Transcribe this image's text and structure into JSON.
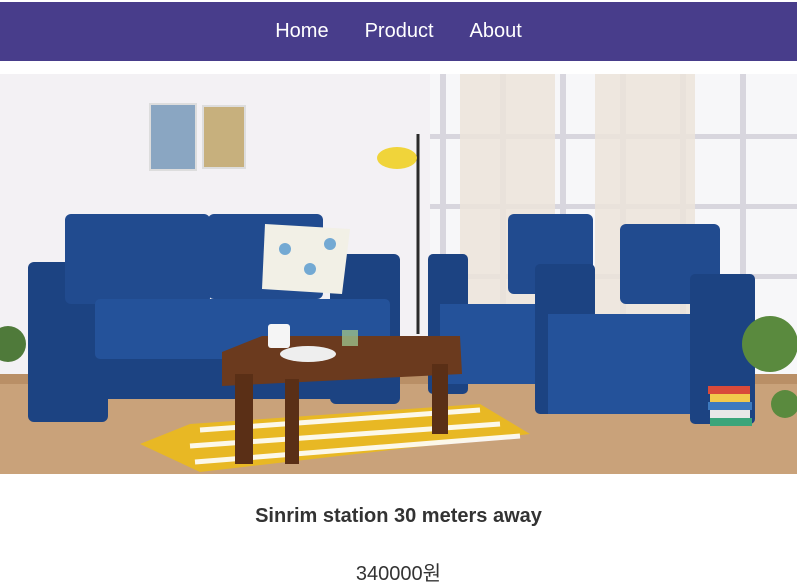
{
  "nav": {
    "items": [
      {
        "label": "Home"
      },
      {
        "label": "Product"
      },
      {
        "label": "About"
      }
    ],
    "background_color": "#483d8b"
  },
  "product": {
    "title": "Sinrim station 30 meters away",
    "price": "340000원"
  },
  "colors": {
    "sofa": "#1f4a8a",
    "floor": "#c9a27a",
    "rug_yellow": "#e8b824",
    "table": "#6b3a1e"
  }
}
